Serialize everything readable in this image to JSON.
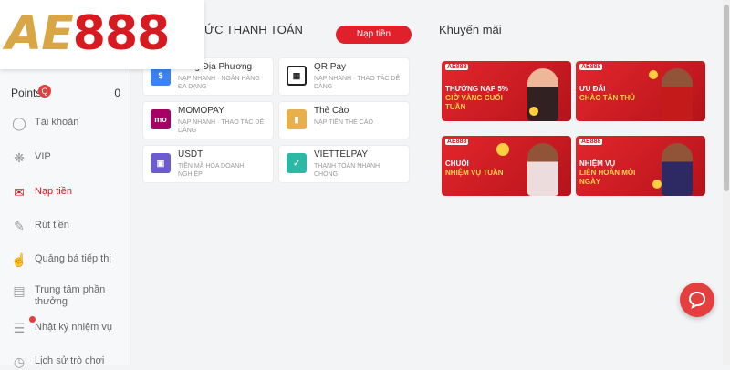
{
  "logo": {
    "ae": "AE",
    "num": "888"
  },
  "points": {
    "label": "Points",
    "badge": "Q",
    "value": "0"
  },
  "sidebar": {
    "items": [
      {
        "label": "Tài khoản",
        "icon": "user-icon"
      },
      {
        "label": "VIP",
        "icon": "vip-icon"
      },
      {
        "label": "Nạp tiền",
        "icon": "deposit-icon"
      },
      {
        "label": "Rút tiền",
        "icon": "withdraw-icon"
      },
      {
        "label": "Quảng bá tiếp thị",
        "icon": "promote-icon"
      },
      {
        "label": "Trung tâm phần thưởng",
        "icon": "gift-icon"
      },
      {
        "label": "Nhật ký nhiệm vụ",
        "icon": "task-log-icon"
      },
      {
        "label": "Lịch sử trò chơi",
        "icon": "history-icon"
      }
    ]
  },
  "payment": {
    "title": "ỨC THANH TOÁN",
    "deposit_button": "Nạp tiền",
    "methods": [
      {
        "name": "Hàng Địa Phương",
        "desc": "Nạp nhanh · Ngân hàng đa dạng"
      },
      {
        "name": "QR Pay",
        "desc": "Nạp nhanh · Thao tác dễ dàng"
      },
      {
        "name": "MOMOPAY",
        "desc": "Nạp nhanh · Thao tác dễ dàng"
      },
      {
        "name": "Thẻ Cào",
        "desc": "Nạp tiền thẻ cào"
      },
      {
        "name": "USDT",
        "desc": "Tiền mã hóa doanh nghiệp"
      },
      {
        "name": "VIETTELPAY",
        "desc": "Thanh toán nhanh chóng"
      }
    ]
  },
  "promotions": {
    "title": "Khuyến mãi",
    "items": [
      {
        "logo": "AE888",
        "line1": "THƯỞNG NẠP 5%",
        "line2": "GIỜ VÀNG CUỐI TUẦN"
      },
      {
        "logo": "AE888",
        "line1": "ƯU ĐÃI",
        "line2": "CHÀO TÂN THỦ"
      },
      {
        "logo": "AE888",
        "line1": "CHUỖI",
        "line2": "NHIỆM VỤ TUẦN"
      },
      {
        "logo": "AE888",
        "line1": "NHIỆM VỤ",
        "line2": "LIÊN HOÀN MỖI NGÀY"
      }
    ]
  },
  "colors": {
    "accent": "#d71920",
    "gold": "#d9a645",
    "bg": "#f3f4f6"
  }
}
